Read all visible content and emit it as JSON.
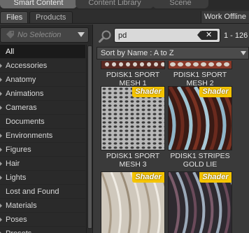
{
  "top_tabs": [
    "Smart Content",
    "Content Library",
    "Scene"
  ],
  "sub_tabs": {
    "files": "Files",
    "products": "Products"
  },
  "work_offline": "Work Offline",
  "selection": {
    "label": "No Selection"
  },
  "categories": [
    {
      "label": "All",
      "selected": true,
      "expandable": false
    },
    {
      "label": "Accessories",
      "expandable": true
    },
    {
      "label": "Anatomy",
      "expandable": true
    },
    {
      "label": "Animations",
      "expandable": true
    },
    {
      "label": "Cameras",
      "expandable": true
    },
    {
      "label": "Documents",
      "expandable": false
    },
    {
      "label": "Environments",
      "expandable": true
    },
    {
      "label": "Figures",
      "expandable": true
    },
    {
      "label": "Hair",
      "expandable": true
    },
    {
      "label": "Lights",
      "expandable": true
    },
    {
      "label": "Lost and Found",
      "expandable": false
    },
    {
      "label": "Materials",
      "expandable": true
    },
    {
      "label": "Poses",
      "expandable": true
    },
    {
      "label": "Presets",
      "expandable": true
    }
  ],
  "search": {
    "value": "pd",
    "placeholder": ""
  },
  "result_range": "1 - 126",
  "sort": {
    "label": "Sort by Name : A to Z"
  },
  "items": [
    {
      "label": "PDISK1 SPORT MESH 1",
      "badge": ""
    },
    {
      "label": "PDISK1 SPORT MESH 2",
      "badge": ""
    },
    {
      "label": "PDISK1 SPORT MESH 3",
      "badge": "Shader"
    },
    {
      "label": "PDISK1 STRIPES GOLD LIE",
      "badge": "Shader"
    },
    {
      "label": "",
      "badge": "Shader"
    },
    {
      "label": "",
      "badge": "Shader"
    }
  ],
  "colors": {
    "badge": "#f5c400",
    "selected_row": "#1a1a1a",
    "panel": "#2a2a2a"
  }
}
